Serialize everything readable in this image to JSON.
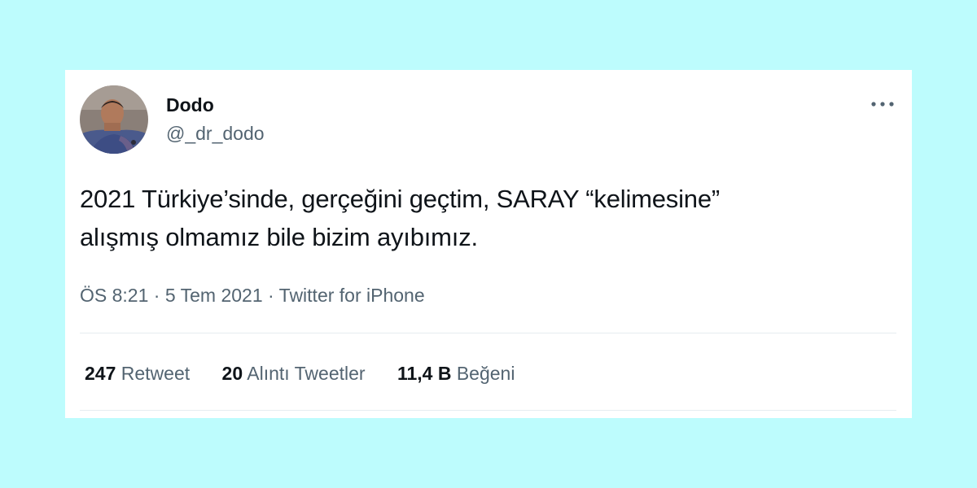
{
  "page": {
    "background": "#bdfcfd"
  },
  "tweet": {
    "author": {
      "display_name": "Dodo",
      "handle": "@_dr_dodo"
    },
    "more_icon": "more-horizontal-icon",
    "text_lines": [
      "2021 Türkiye’sinde, gerçeğini geçtim, SARAY “kelimesine”",
      "alışmış olmamız bile bizim ayıbımız."
    ],
    "meta": {
      "time": "ÖS 8:21",
      "separator": "·",
      "date": "5 Tem 2021",
      "source": "Twitter for iPhone"
    },
    "stats": [
      {
        "count": "247",
        "label": "Retweet"
      },
      {
        "count": "20",
        "label": "Alıntı Tweetler"
      },
      {
        "count": "11,4 B",
        "label": "Beğeni"
      }
    ]
  }
}
